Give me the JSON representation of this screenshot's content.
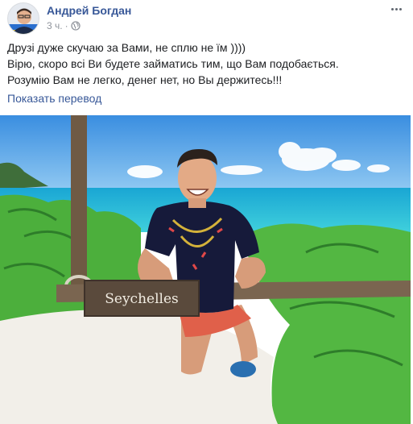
{
  "post": {
    "author": "Андрей Богдан",
    "time": "3 ч.",
    "privacy_separator": "·",
    "privacy_icon": "globe-icon",
    "more_icon": "more-options-icon",
    "text_lines": [
      "Друзі дуже скучаю за Вами, не сплю не їм ))))",
      "Вірю, скоро всі Ви будете займатись тим, що Вам подобається.",
      "Розумію Вам не легко, денег нет, но Вы держитесь!!!"
    ],
    "translate_link": "Показать перевод"
  },
  "photo": {
    "sign_text": "Seychelles",
    "colors": {
      "sky_top": "#3a8ee0",
      "sky_bottom": "#8fc8f2",
      "sea": "#22b8d8",
      "sand": "#f2efe9",
      "foliage": "#4caf3c",
      "shirt": "#161a3a",
      "sign": "#5a4a3c"
    }
  },
  "colors": {
    "link": "#385898",
    "meta": "#90949c",
    "text": "#1c1e21"
  }
}
